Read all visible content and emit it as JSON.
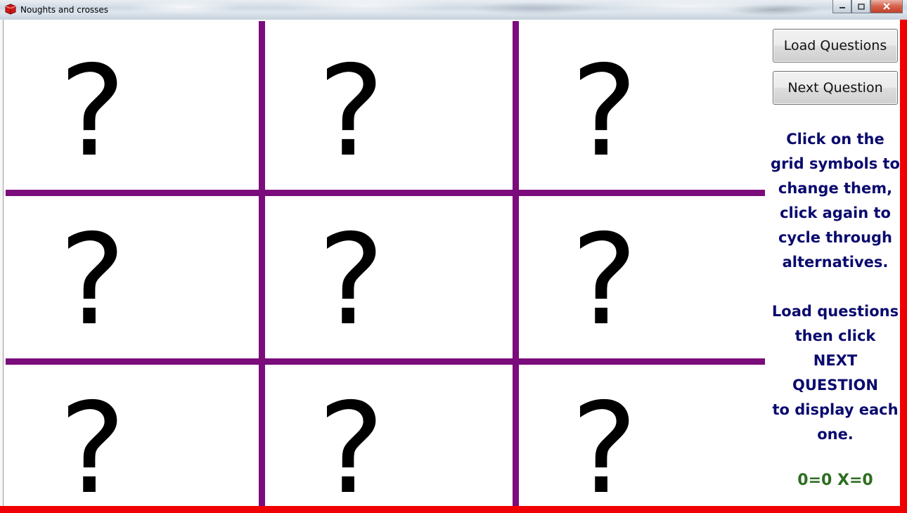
{
  "window": {
    "title": "Noughts and crosses",
    "frame_color": "#f00000"
  },
  "grid": {
    "line_color": "#7b0c7b",
    "cells": [
      {
        "symbol": "?"
      },
      {
        "symbol": "?"
      },
      {
        "symbol": "?"
      },
      {
        "symbol": "?"
      },
      {
        "symbol": "?"
      },
      {
        "symbol": "?"
      },
      {
        "symbol": "?"
      },
      {
        "symbol": "?"
      },
      {
        "symbol": "?"
      }
    ]
  },
  "panel": {
    "load_questions_label": "Load Questions",
    "next_question_label": "Next Question",
    "instructions": "Click on the\ngrid symbols to\nchange them,\nclick again to\ncycle through\nalternatives.\n\nLoad questions\nthen click\nNEXT\nQUESTION\nto display each\none.",
    "instructions_color": "#0a0a6e",
    "score": "0=0 X=0",
    "score_color": "#2c6e1f"
  },
  "icons": {
    "app": "app-icon",
    "minimize": "minimize-icon",
    "maximize": "maximize-icon",
    "close": "close-icon"
  }
}
